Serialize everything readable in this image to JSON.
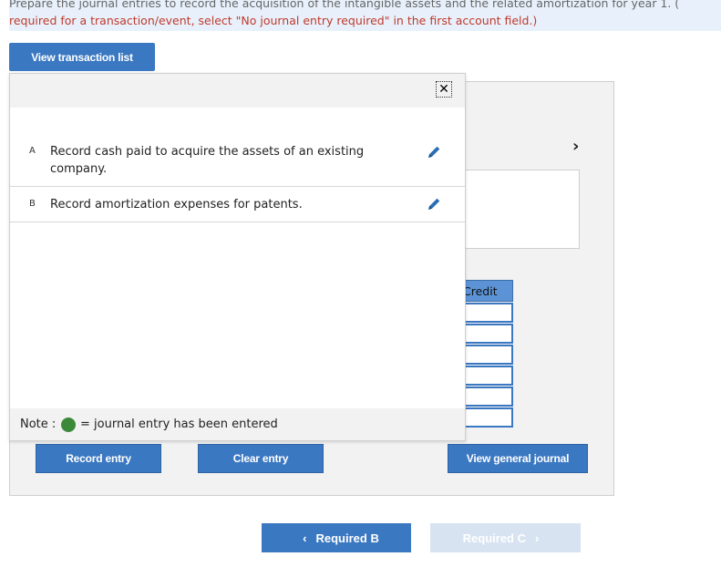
{
  "instructions": {
    "line1": "Prepare the journal entries to record the acquisition of the intangible assets and the related amortization for year 1. (",
    "line2": "required for a transaction/event, select \"No journal entry required\" in the first account field.)"
  },
  "toolbar": {
    "view_transaction_list": "View transaction list"
  },
  "popup": {
    "close_glyph": "✕",
    "transactions": [
      {
        "letter": "A",
        "description": "Record cash paid to acquire the assets of an existing company."
      },
      {
        "letter": "B",
        "description": "Record amortization expenses for patents."
      }
    ],
    "note_label": "Note :",
    "note_text": "= journal entry has been entered"
  },
  "journal": {
    "credit_header": "Credit",
    "next_glyph": "›"
  },
  "actions": {
    "record_entry": "Record entry",
    "clear_entry": "Clear entry",
    "view_general_journal": "View general journal"
  },
  "navigation": {
    "prev_label": "Required B",
    "next_label": "Required C",
    "prev_chevron": "‹",
    "next_chevron": "›"
  },
  "colors": {
    "accent": "#3b78c2",
    "entered_status": "#3a8a3a",
    "instruction_text": "#c0392b"
  }
}
